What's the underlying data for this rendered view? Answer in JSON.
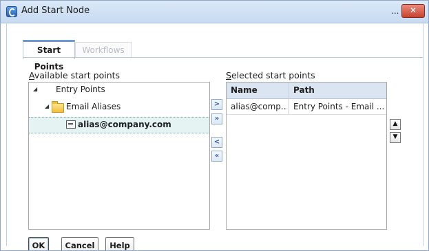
{
  "window": {
    "title": "Add Start Node",
    "title_extra": "...",
    "close_glyph": "✕"
  },
  "tabs": [
    {
      "label": "Start Points",
      "active": true
    },
    {
      "label": "Workflows",
      "active": false
    }
  ],
  "available": {
    "label_prefix": "A",
    "label_rest": "vailable start points",
    "tree": {
      "root": "Entry Points",
      "folder": "Email Aliases",
      "item": "alias@company.com"
    }
  },
  "selected": {
    "label_prefix": "S",
    "label_rest": "elected start points",
    "columns": [
      "Name",
      "Path"
    ],
    "rows": [
      {
        "name": "alias@comp...",
        "path": "Entry Points - Email ..."
      }
    ]
  },
  "transfer_buttons": {
    "add": ">",
    "add_all": "»",
    "remove": "<",
    "remove_all": "«"
  },
  "order_buttons": {
    "up": "▲",
    "down": "▼"
  },
  "buttons": {
    "ok": "OK",
    "cancel": "Cancel",
    "help": "Help"
  },
  "colors": {
    "accent": "#6a9ad0",
    "close": "#c7432f",
    "header_bg": "#dbe5f1"
  }
}
